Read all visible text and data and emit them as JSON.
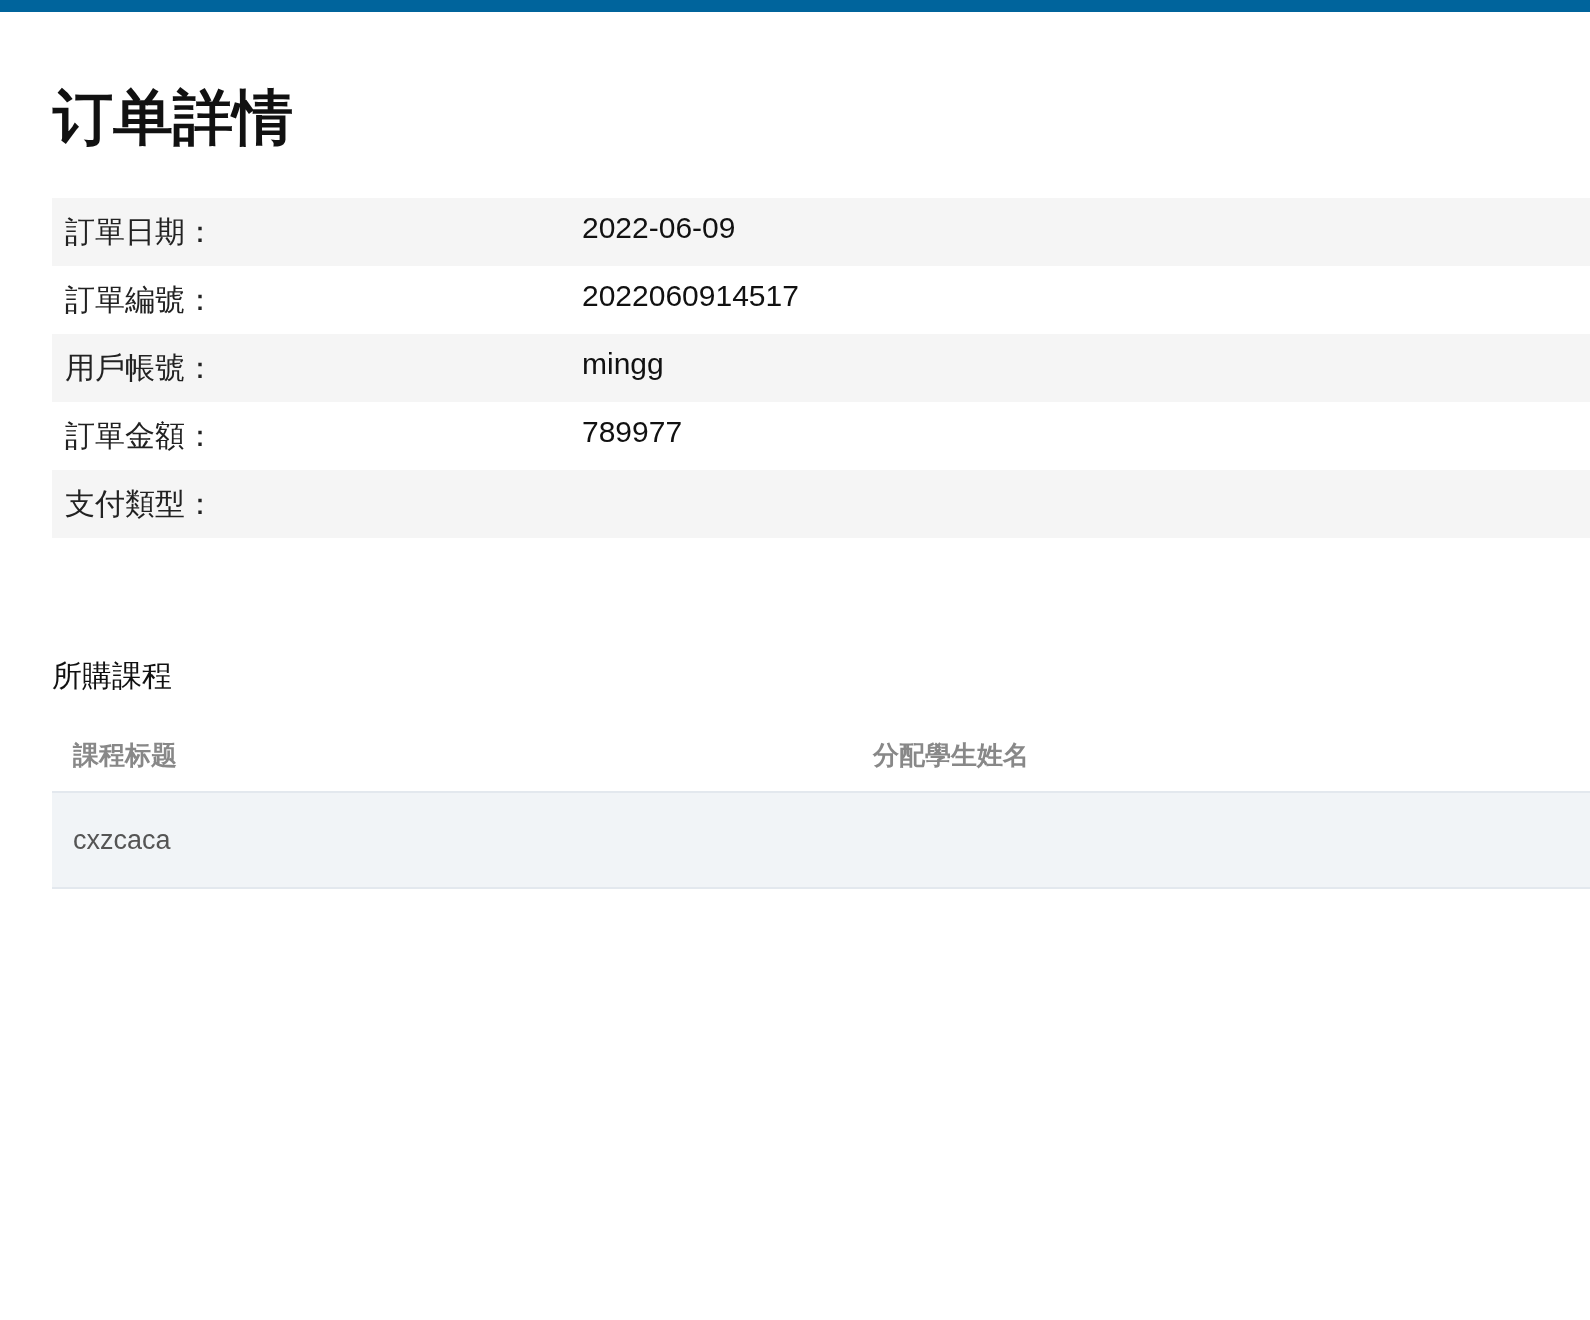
{
  "title": "订单詳情",
  "details": [
    {
      "label": "訂單日期：",
      "value": "2022-06-09"
    },
    {
      "label": "訂單編號：",
      "value": "2022060914517"
    },
    {
      "label": "用戶帳號：",
      "value": "mingg"
    },
    {
      "label": "訂單金額：",
      "value": "789977"
    },
    {
      "label": "支付類型："
    }
  ],
  "courses": {
    "heading": "所購課程",
    "columns": [
      "課程标题",
      "分配學生姓名"
    ],
    "rows": [
      [
        "cxzcaca"
      ]
    ]
  }
}
